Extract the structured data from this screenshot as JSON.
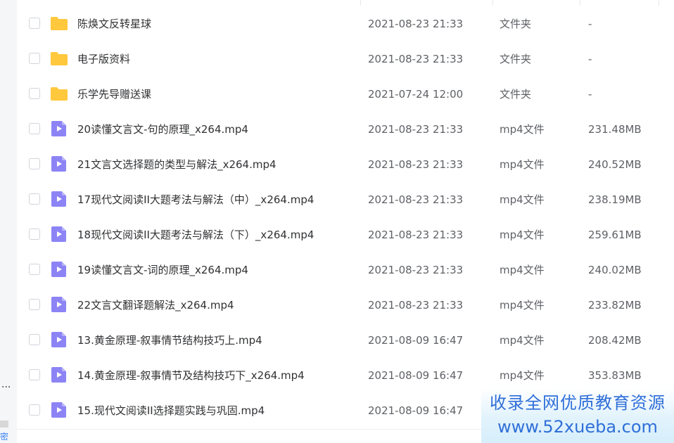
{
  "colors": {
    "folder": "#ffc83d",
    "video": "#8c84f5",
    "watermark": "#2f6fd8"
  },
  "left_edge": {
    "ellipsis": "...",
    "cut_text": "密"
  },
  "files": [
    {
      "icon": "folder-icon",
      "name": "陈焕文反转星球",
      "date": "2021-08-23 21:33",
      "type": "文件夹",
      "size": "-"
    },
    {
      "icon": "folder-icon",
      "name": "电子版资料",
      "date": "2021-08-23 21:33",
      "type": "文件夹",
      "size": "-"
    },
    {
      "icon": "folder-icon",
      "name": "乐学先导赠送课",
      "date": "2021-07-24 12:00",
      "type": "文件夹",
      "size": "-"
    },
    {
      "icon": "video-file-icon",
      "name": "20读懂文言文-句的原理_x264.mp4",
      "date": "2021-08-23 21:33",
      "type": "mp4文件",
      "size": "231.48MB"
    },
    {
      "icon": "video-file-icon",
      "name": "21文言文选择题的类型与解法_x264.mp4",
      "date": "2021-08-23 21:33",
      "type": "mp4文件",
      "size": "240.52MB"
    },
    {
      "icon": "video-file-icon",
      "name": "17现代文阅读II大题考法与解法（中）_x264.mp4",
      "date": "2021-08-23 21:33",
      "type": "mp4文件",
      "size": "238.19MB"
    },
    {
      "icon": "video-file-icon",
      "name": "18现代文阅读II大题考法与解法（下）_x264.mp4",
      "date": "2021-08-23 21:33",
      "type": "mp4文件",
      "size": "259.61MB"
    },
    {
      "icon": "video-file-icon",
      "name": "19读懂文言文-词的原理_x264.mp4",
      "date": "2021-08-23 21:33",
      "type": "mp4文件",
      "size": "240.02MB"
    },
    {
      "icon": "video-file-icon",
      "name": "22文言文翻译题解法_x264.mp4",
      "date": "2021-08-23 21:33",
      "type": "mp4文件",
      "size": "233.82MB"
    },
    {
      "icon": "video-file-icon",
      "name": "13.黄金原理-叙事情节结构技巧上.mp4",
      "date": "2021-08-09 16:47",
      "type": "mp4文件",
      "size": "208.42MB"
    },
    {
      "icon": "video-file-icon",
      "name": "14.黄金原理-叙事情节及结构技巧下_x264.mp4",
      "date": "2021-08-09 16:47",
      "type": "mp4文件",
      "size": "353.83MB"
    },
    {
      "icon": "video-file-icon",
      "name": "15.现代文阅读II选择题实践与巩固.mp4",
      "date": "2021-08-09 16:47",
      "type": "",
      "size": ""
    }
  ],
  "watermark": {
    "line1": "收录全网优质教育资源",
    "line2": "www.52xueba.com"
  }
}
